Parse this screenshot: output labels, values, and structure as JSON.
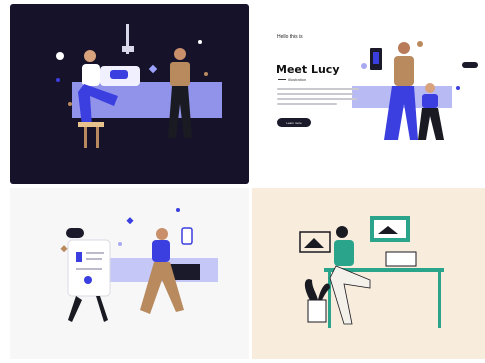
{
  "tiles": [
    {
      "name": "dark-workspace-illustration",
      "background": "#15122a"
    },
    {
      "name": "meet-lucy-hero-illustration",
      "background": "#ffffff"
    },
    {
      "name": "running-document-illustration",
      "background": "#f7f7f8"
    },
    {
      "name": "desk-monitor-illustration",
      "background": "#f8ecdc"
    }
  ],
  "hero": {
    "small_label": "Hello this is",
    "title": "Meet Lucy",
    "subtitle": "Illustration",
    "button": "Learn more"
  },
  "colors": {
    "accent_blue": "#3b3fe0",
    "lavender": "#a8aaf0",
    "navy": "#15122a",
    "teal": "#2aa58c",
    "tan": "#b88a5e"
  }
}
